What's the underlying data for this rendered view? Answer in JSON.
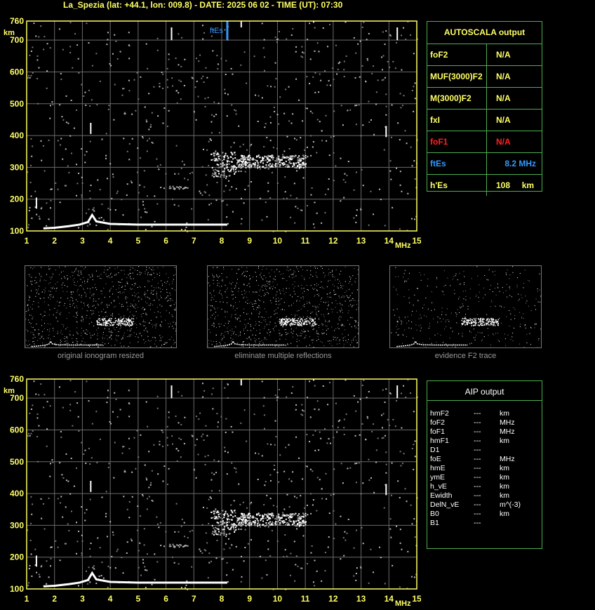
{
  "title": "La_Spezia (lat: +44.1, lon: 009.8) - DATE: 2025 06 02 - TIME (UT): 07:30",
  "colors": {
    "axis": "#ffff66",
    "grid": "#6a6a6a",
    "trace": "#ffffff",
    "ftes": "#3399ff",
    "panel_border": "#4caf50",
    "foF1": "#ff2222"
  },
  "axis_labels": {
    "unit_y": "km",
    "unit_x": "MHz"
  },
  "autoscala": {
    "title": "AUTOSCALA output",
    "rows": [
      {
        "label": "foF2",
        "value": "N/A"
      },
      {
        "label": "MUF(3000)F2",
        "value": "N/A"
      },
      {
        "label": "M(3000)F2",
        "value": "N/A"
      },
      {
        "label": "fxI",
        "value": "N/A"
      },
      {
        "label": "foF1",
        "value": "N/A"
      },
      {
        "label": "ftEs",
        "value": "8.2 MHz"
      },
      {
        "label": "h'Es",
        "value": "108     km"
      }
    ]
  },
  "aip": {
    "title": "AIP output",
    "rows": [
      {
        "param": "hmF2",
        "value": "---",
        "unit": "km"
      },
      {
        "param": "foF2",
        "value": "---",
        "unit": "MHz"
      },
      {
        "param": "foF1",
        "value": "---",
        "unit": "MHz"
      },
      {
        "param": "hmF1",
        "value": "---",
        "unit": "km"
      },
      {
        "param": "D1",
        "value": "---",
        "unit": ""
      },
      {
        "param": "foE",
        "value": "---",
        "unit": "MHz"
      },
      {
        "param": "hmE",
        "value": "---",
        "unit": "km"
      },
      {
        "param": "ymE",
        "value": "---",
        "unit": "km"
      },
      {
        "param": "h_vE",
        "value": "---",
        "unit": "km"
      },
      {
        "param": "Ewidth",
        "value": "---",
        "unit": "km"
      },
      {
        "param": "DelN_vE",
        "value": "---",
        "unit": "m^(-3)"
      },
      {
        "param": "B0",
        "value": "---",
        "unit": "km"
      },
      {
        "param": "B1",
        "value": "---",
        "unit": ""
      }
    ]
  },
  "captions": {
    "original": "original ionogram resized",
    "eliminate": "eliminate multiple reflections",
    "evidence": "evidence F2 trace"
  },
  "chart_data": [
    {
      "type": "scatter",
      "name": "autoscala ionogram",
      "xlim": [
        1,
        15
      ],
      "ylim": [
        100,
        760
      ],
      "x_ticks": [
        1,
        2,
        3,
        4,
        5,
        6,
        7,
        8,
        9,
        10,
        11,
        12,
        13,
        14,
        15
      ],
      "y_ticks": [
        100,
        200,
        300,
        400,
        500,
        600,
        700,
        760
      ],
      "grid": true,
      "annotation": {
        "label": "ftEs",
        "x": 8.2,
        "y_range": [
          700,
          760
        ]
      },
      "traces": {
        "Es_trace": [
          [
            1.6,
            108
          ],
          [
            2.0,
            110
          ],
          [
            2.5,
            115
          ],
          [
            2.9,
            120
          ],
          [
            3.2,
            128
          ],
          [
            3.35,
            150
          ],
          [
            3.5,
            130
          ],
          [
            4.0,
            122
          ],
          [
            5.0,
            120
          ],
          [
            6.0,
            120
          ],
          [
            7.0,
            120
          ],
          [
            8.2,
            120
          ]
        ],
        "F_cloud": {
          "x_range": [
            7.6,
            11.0
          ],
          "y_range": [
            270,
            350
          ]
        },
        "small_patch": {
          "x_range": [
            6.1,
            6.8
          ],
          "y_range": [
            233,
            243
          ]
        }
      }
    },
    {
      "type": "scatter",
      "name": "AIP ionogram",
      "xlim": [
        1,
        15
      ],
      "ylim": [
        100,
        760
      ],
      "x_ticks": [
        1,
        2,
        3,
        4,
        5,
        6,
        7,
        8,
        9,
        10,
        11,
        12,
        13,
        14,
        15
      ],
      "y_ticks": [
        100,
        200,
        300,
        400,
        500,
        600,
        700,
        760
      ],
      "grid": true
    }
  ]
}
